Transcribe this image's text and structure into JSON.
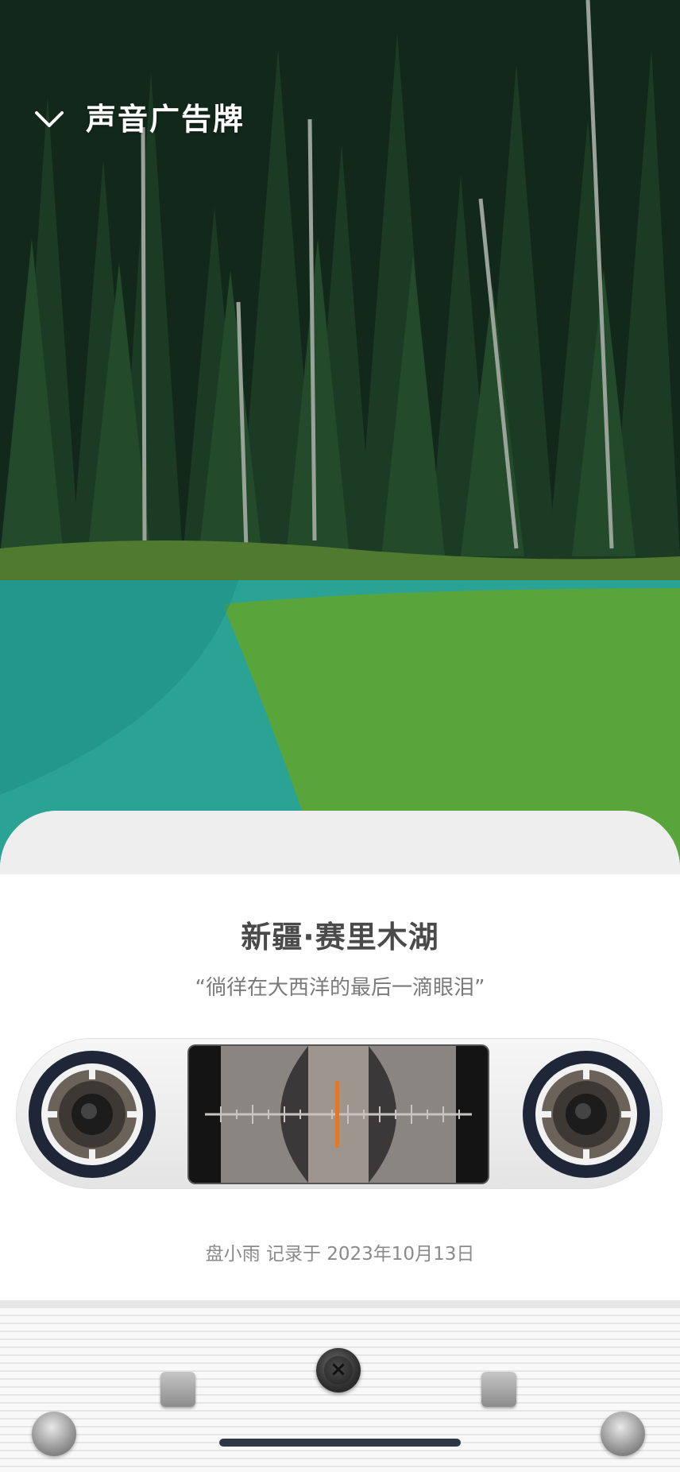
{
  "header": {
    "title": "声音广告牌",
    "back_icon": "chevron-down-icon"
  },
  "card": {
    "place_title": "新疆·赛里木湖",
    "quote": "“徜徉在大西洋的最后一滴眼泪”",
    "recorded_text": "盘小雨 记录于 2023年10月13日"
  },
  "colors": {
    "tuner_needle": "#e07a2a",
    "title_text": "#4a4a4a",
    "card_background": "#ffffff"
  }
}
